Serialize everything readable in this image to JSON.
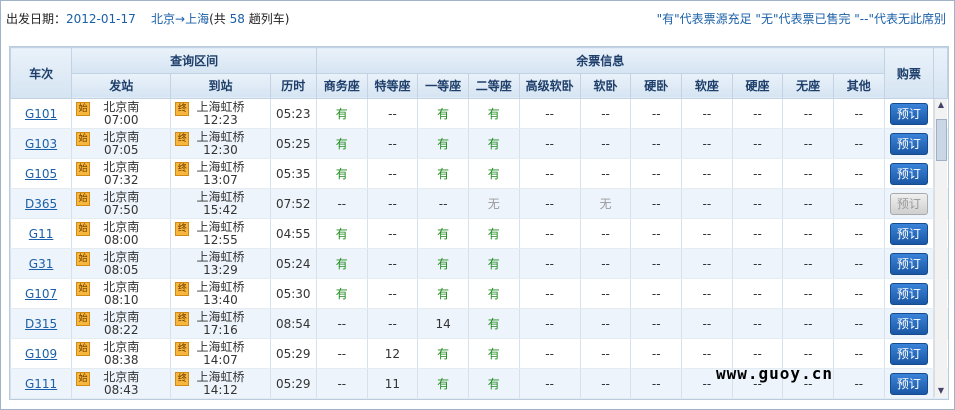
{
  "header": {
    "date_label": "出发日期：",
    "date_value": "2012-01-17",
    "route_from": "北京",
    "route_arrow": "→",
    "route_to": "上海",
    "count_prefix": "(共 ",
    "count_value": "58",
    "count_suffix": " 趟列车)",
    "legend": "\"有\"代表票源充足  \"无\"代表票已售完  \"--\"代表无此席别"
  },
  "table": {
    "group_headers": {
      "query_range": "查询区间",
      "remaining": "余票信息"
    },
    "headers": {
      "train": "车次",
      "from": "发站",
      "to": "到站",
      "duration": "历时",
      "buy": "购票",
      "seats": [
        "商务座",
        "特等座",
        "一等座",
        "二等座",
        "高级软卧",
        "软卧",
        "硬卧",
        "软座",
        "硬座",
        "无座",
        "其他"
      ]
    },
    "rows": [
      {
        "train": "G101",
        "from": "北京南",
        "dep": "07:00",
        "to": "上海虹桥",
        "arr": "12:23",
        "dur": "05:23",
        "from_badge": "始",
        "to_badge": "终",
        "seats": [
          "有",
          "--",
          "有",
          "有",
          "--",
          "--",
          "--",
          "--",
          "--",
          "--",
          "--"
        ],
        "buy": "预订",
        "buy_enabled": true
      },
      {
        "train": "G103",
        "from": "北京南",
        "dep": "07:05",
        "to": "上海虹桥",
        "arr": "12:30",
        "dur": "05:25",
        "from_badge": "始",
        "to_badge": "终",
        "seats": [
          "有",
          "--",
          "有",
          "有",
          "--",
          "--",
          "--",
          "--",
          "--",
          "--",
          "--"
        ],
        "buy": "预订",
        "buy_enabled": true
      },
      {
        "train": "G105",
        "from": "北京南",
        "dep": "07:32",
        "to": "上海虹桥",
        "arr": "13:07",
        "dur": "05:35",
        "from_badge": "始",
        "to_badge": "终",
        "seats": [
          "有",
          "--",
          "有",
          "有",
          "--",
          "--",
          "--",
          "--",
          "--",
          "--",
          "--"
        ],
        "buy": "预订",
        "buy_enabled": true
      },
      {
        "train": "D365",
        "from": "北京南",
        "dep": "07:50",
        "to": "上海虹桥",
        "arr": "15:42",
        "dur": "07:52",
        "from_badge": "始",
        "to_badge": "",
        "seats": [
          "--",
          "--",
          "--",
          "无",
          "--",
          "无",
          "--",
          "--",
          "--",
          "--",
          "--"
        ],
        "buy": "预订",
        "buy_enabled": false
      },
      {
        "train": "G11",
        "from": "北京南",
        "dep": "08:00",
        "to": "上海虹桥",
        "arr": "12:55",
        "dur": "04:55",
        "from_badge": "始",
        "to_badge": "终",
        "seats": [
          "有",
          "--",
          "有",
          "有",
          "--",
          "--",
          "--",
          "--",
          "--",
          "--",
          "--"
        ],
        "buy": "预订",
        "buy_enabled": true
      },
      {
        "train": "G31",
        "from": "北京南",
        "dep": "08:05",
        "to": "上海虹桥",
        "arr": "13:29",
        "dur": "05:24",
        "from_badge": "始",
        "to_badge": "",
        "seats": [
          "有",
          "--",
          "有",
          "有",
          "--",
          "--",
          "--",
          "--",
          "--",
          "--",
          "--"
        ],
        "buy": "预订",
        "buy_enabled": true
      },
      {
        "train": "G107",
        "from": "北京南",
        "dep": "08:10",
        "to": "上海虹桥",
        "arr": "13:40",
        "dur": "05:30",
        "from_badge": "始",
        "to_badge": "终",
        "seats": [
          "有",
          "--",
          "有",
          "有",
          "--",
          "--",
          "--",
          "--",
          "--",
          "--",
          "--"
        ],
        "buy": "预订",
        "buy_enabled": true
      },
      {
        "train": "D315",
        "from": "北京南",
        "dep": "08:22",
        "to": "上海虹桥",
        "arr": "17:16",
        "dur": "08:54",
        "from_badge": "始",
        "to_badge": "终",
        "seats": [
          "--",
          "--",
          "14",
          "有",
          "--",
          "--",
          "--",
          "--",
          "--",
          "--",
          "--"
        ],
        "buy": "预订",
        "buy_enabled": true
      },
      {
        "train": "G109",
        "from": "北京南",
        "dep": "08:38",
        "to": "上海虹桥",
        "arr": "14:07",
        "dur": "05:29",
        "from_badge": "始",
        "to_badge": "终",
        "seats": [
          "--",
          "12",
          "有",
          "有",
          "--",
          "--",
          "--",
          "--",
          "--",
          "--",
          "--"
        ],
        "buy": "预订",
        "buy_enabled": true
      },
      {
        "train": "G111",
        "from": "北京南",
        "dep": "08:43",
        "to": "上海虹桥",
        "arr": "14:12",
        "dur": "05:29",
        "from_badge": "始",
        "to_badge": "终",
        "seats": [
          "--",
          "11",
          "有",
          "有",
          "--",
          "--",
          "--",
          "--",
          "--",
          "--",
          "--"
        ],
        "buy": "预订",
        "buy_enabled": true
      }
    ]
  },
  "watermark": "www.guoy.cn"
}
